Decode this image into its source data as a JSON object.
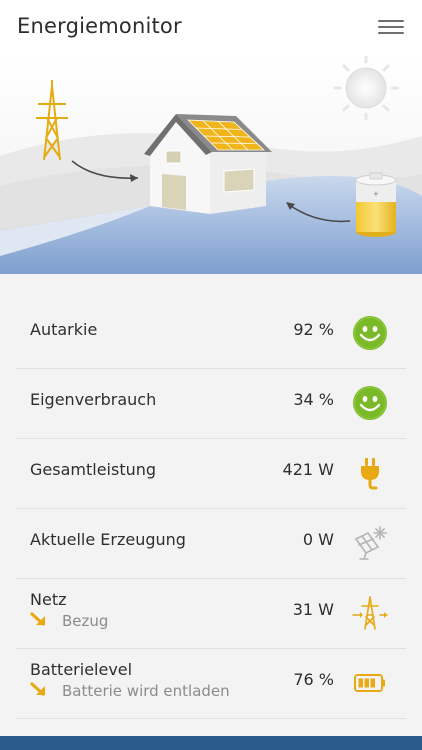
{
  "header": {
    "title": "Energiemonitor"
  },
  "colors": {
    "accent": "#e8a912",
    "green": "#7ab928",
    "list_bg": "#f3f3f3",
    "bottom_bar": "#2a5a8c"
  },
  "rows": [
    {
      "label": "Autarkie",
      "value": "92 %",
      "icon": "smiley-icon"
    },
    {
      "label": "Eigenverbrauch",
      "value": "34 %",
      "icon": "smiley-icon"
    },
    {
      "label": "Gesamtleistung",
      "value": "421 W",
      "icon": "plug-icon"
    },
    {
      "label": "Aktuelle Erzeugung",
      "value": "0 W",
      "icon": "solar-panel-icon"
    },
    {
      "label": "Netz",
      "sub": "Bezug",
      "value": "31 W",
      "icon": "power-pylon-icon"
    },
    {
      "label": "Batterielevel",
      "sub": "Batterie wird entladen",
      "value": "76 %",
      "icon": "battery-icon"
    }
  ]
}
